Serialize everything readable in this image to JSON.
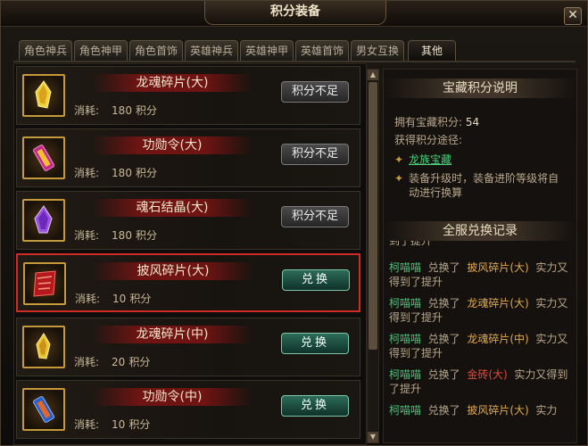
{
  "window": {
    "title": "积分装备",
    "close_label": "✕"
  },
  "tabs": [
    {
      "label": "角色神兵",
      "active": false
    },
    {
      "label": "角色神甲",
      "active": false
    },
    {
      "label": "角色首饰",
      "active": false
    },
    {
      "label": "英雄神兵",
      "active": false
    },
    {
      "label": "英雄神甲",
      "active": false
    },
    {
      "label": "英雄首饰",
      "active": false
    },
    {
      "label": "男女互换",
      "active": false
    },
    {
      "label": "其他",
      "active": true
    }
  ],
  "items": [
    {
      "name": "龙魂碎片(大)",
      "cost_label": "消耗:",
      "cost": "180",
      "unit": "积分",
      "button": "积分不足",
      "enabled": false,
      "icon": "yellow-crystal-icon"
    },
    {
      "name": "功勋令(大)",
      "cost_label": "消耗:",
      "cost": "180",
      "unit": "积分",
      "button": "积分不足",
      "enabled": false,
      "icon": "purple-medal-icon"
    },
    {
      "name": "魂石结晶(大)",
      "cost_label": "消耗:",
      "cost": "180",
      "unit": "积分",
      "button": "积分不足",
      "enabled": false,
      "icon": "purple-crystal-icon"
    },
    {
      "name": "披风碎片(大)",
      "cost_label": "消耗:",
      "cost": "10",
      "unit": "积分",
      "button": "兑换",
      "enabled": true,
      "icon": "red-cloak-shard-icon",
      "selected": true
    },
    {
      "name": "龙魂碎片(中)",
      "cost_label": "消耗:",
      "cost": "20",
      "unit": "积分",
      "button": "兑换",
      "enabled": true,
      "icon": "yellow-crystal-icon"
    },
    {
      "name": "功勋令(中)",
      "cost_label": "消耗:",
      "cost": "10",
      "unit": "积分",
      "button": "兑换",
      "enabled": true,
      "icon": "blue-medal-icon"
    }
  ],
  "treasure": {
    "heading": "宝藏积分说明",
    "owned_label": "拥有宝藏积分:",
    "owned_value": "54",
    "method_label": "获得积分途径:",
    "link": "龙族宝藏",
    "note": "装备升级时，装备进阶等级将自动进行换算"
  },
  "records": {
    "heading": "全服兑换记录",
    "partial_top": "到了提升",
    "entries": [
      {
        "player": "柯喵喵",
        "verb": "兑换了",
        "item": "披风碎片(大)",
        "tail": "实力又得到了提升",
        "red": false
      },
      {
        "player": "柯喵喵",
        "verb": "兑换了",
        "item": "龙魂碎片(大)",
        "tail": "实力又得到了提升",
        "red": false
      },
      {
        "player": "柯喵喵",
        "verb": "兑换了",
        "item": "龙魂碎片(中)",
        "tail": "实力又得到了提升",
        "red": false
      },
      {
        "player": "柯喵喵",
        "verb": "兑换了",
        "item": "金砖(大)",
        "tail": "实力又得到了提升",
        "red": true
      },
      {
        "player": "柯喵喵",
        "verb": "兑换了",
        "item": "披风碎片(大)",
        "tail": "实力",
        "red": false
      }
    ]
  },
  "colors": {
    "accent_gold": "#c69a3a",
    "highlight_red": "#d12b26",
    "link_green": "#49d07b"
  }
}
